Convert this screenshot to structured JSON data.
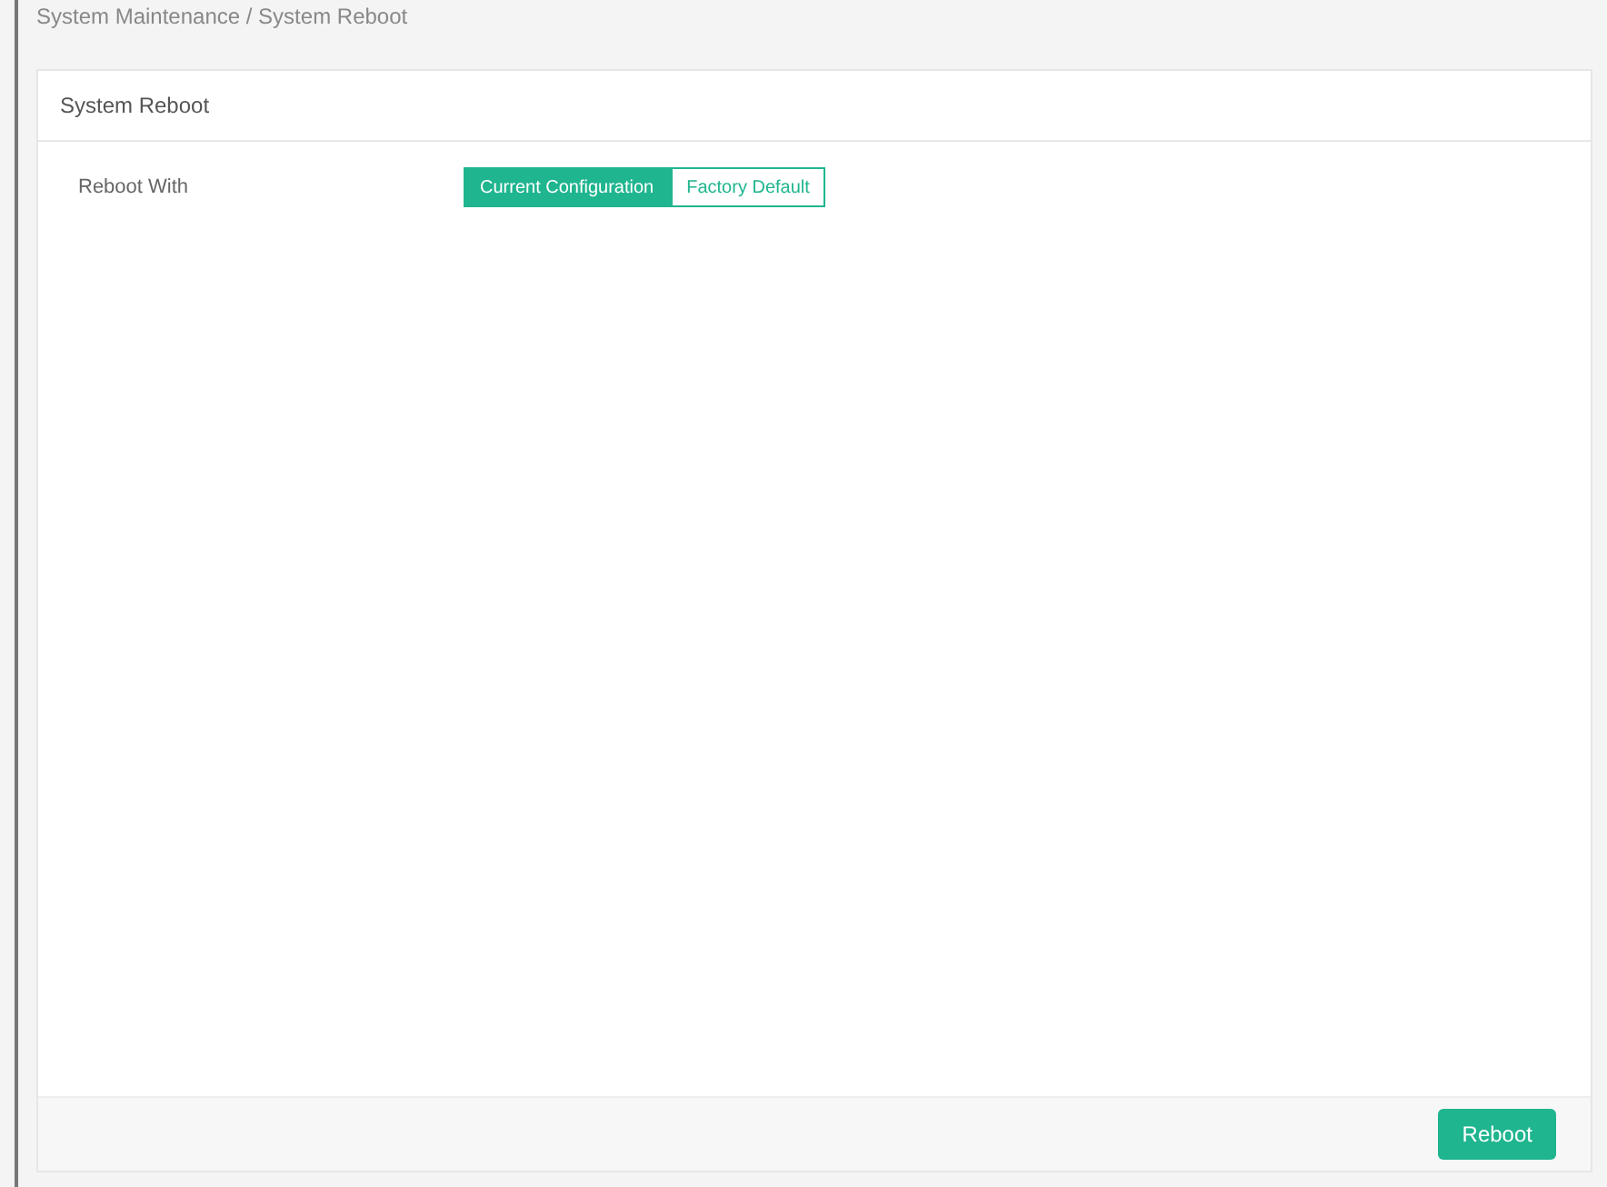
{
  "breadcrumb": "System Maintenance / System Reboot",
  "panel": {
    "title": "System Reboot"
  },
  "reboot_with": {
    "label": "Reboot With",
    "options": [
      {
        "label": "Current Configuration",
        "selected": true
      },
      {
        "label": "Factory Default",
        "selected": false
      }
    ]
  },
  "buttons": [
    "Reboot"
  ]
}
